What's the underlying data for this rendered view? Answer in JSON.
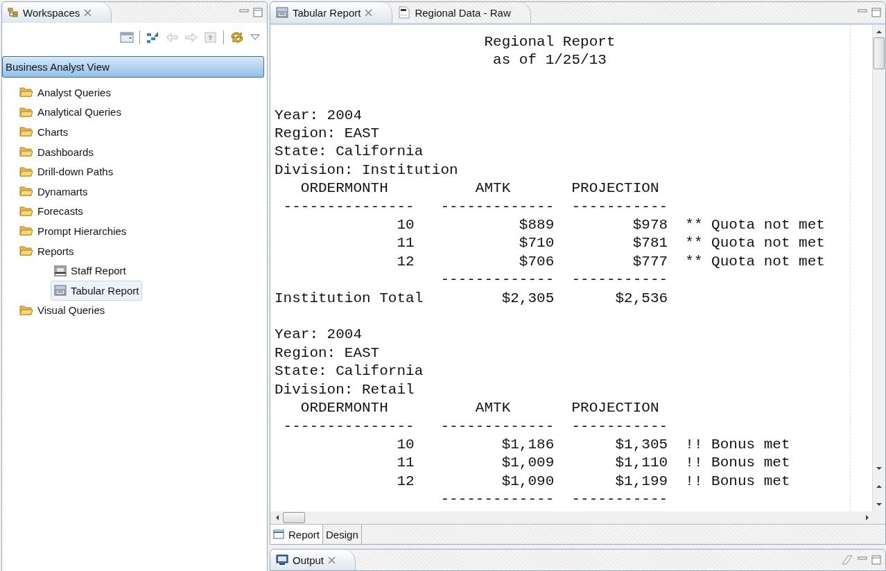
{
  "workspaces_panel": {
    "tab": {
      "label": "Workspaces",
      "closable": true
    },
    "view_selector": "Business Analyst View",
    "tree": [
      {
        "label": "Analyst Queries",
        "kind": "folder",
        "selected": false
      },
      {
        "label": "Analytical Queries",
        "kind": "folder",
        "selected": false
      },
      {
        "label": "Charts",
        "kind": "folder",
        "selected": false
      },
      {
        "label": "Dashboards",
        "kind": "folder",
        "selected": false
      },
      {
        "label": "Drill-down Paths",
        "kind": "folder",
        "selected": false
      },
      {
        "label": "Dynamarts",
        "kind": "folder",
        "selected": false
      },
      {
        "label": "Forecasts",
        "kind": "folder",
        "selected": false
      },
      {
        "label": "Prompt Hierarchies",
        "kind": "folder",
        "selected": false
      },
      {
        "label": "Reports",
        "kind": "folder",
        "selected": false,
        "children": [
          {
            "label": "Staff Report",
            "kind": "staff-report",
            "selected": false
          },
          {
            "label": "Tabular Report",
            "kind": "tabular-report",
            "selected": true
          }
        ]
      },
      {
        "label": "Visual Queries",
        "kind": "folder",
        "selected": false
      }
    ]
  },
  "editor": {
    "tabs": [
      {
        "label": "Tabular Report",
        "kind": "report",
        "selected": true,
        "closable": true
      },
      {
        "label": "Regional Data - Raw",
        "kind": "sql",
        "selected": false,
        "closable": false
      }
    ],
    "report": {
      "title_lines": [
        "                        Regional Report",
        "                         as of 1/25/13"
      ],
      "sections": [
        {
          "lines": [
            "Year: 2004",
            "Region: EAST",
            "State: California",
            "Division: Institution",
            "   ORDERMONTH          AMTK       PROJECTION",
            " ---------------   -------------  -----------",
            "              10            $889         $978  ** Quota not met",
            "              11            $710         $781  ** Quota not met",
            "              12            $706         $777  ** Quota not met",
            "                   -------------  -----------",
            "Institution Total         $2,305       $2,536"
          ]
        },
        {
          "lines": [
            "Year: 2004",
            "Region: EAST",
            "State: California",
            "Division: Retail",
            "   ORDERMONTH          AMTK       PROJECTION",
            " ---------------   -------------  -----------",
            "              10          $1,186       $1,305  !! Bonus met",
            "              11          $1,009       $1,110  !! Bonus met",
            "              12          $1,090       $1,199  !! Bonus met",
            "                   -------------  -----------"
          ]
        }
      ]
    },
    "bottom_tabs": [
      {
        "label": "Report",
        "selected": true,
        "icon": true
      },
      {
        "label": "Design",
        "selected": false,
        "icon": false
      }
    ]
  },
  "output_panel": {
    "tab": {
      "label": "Output",
      "closable": true
    }
  }
}
